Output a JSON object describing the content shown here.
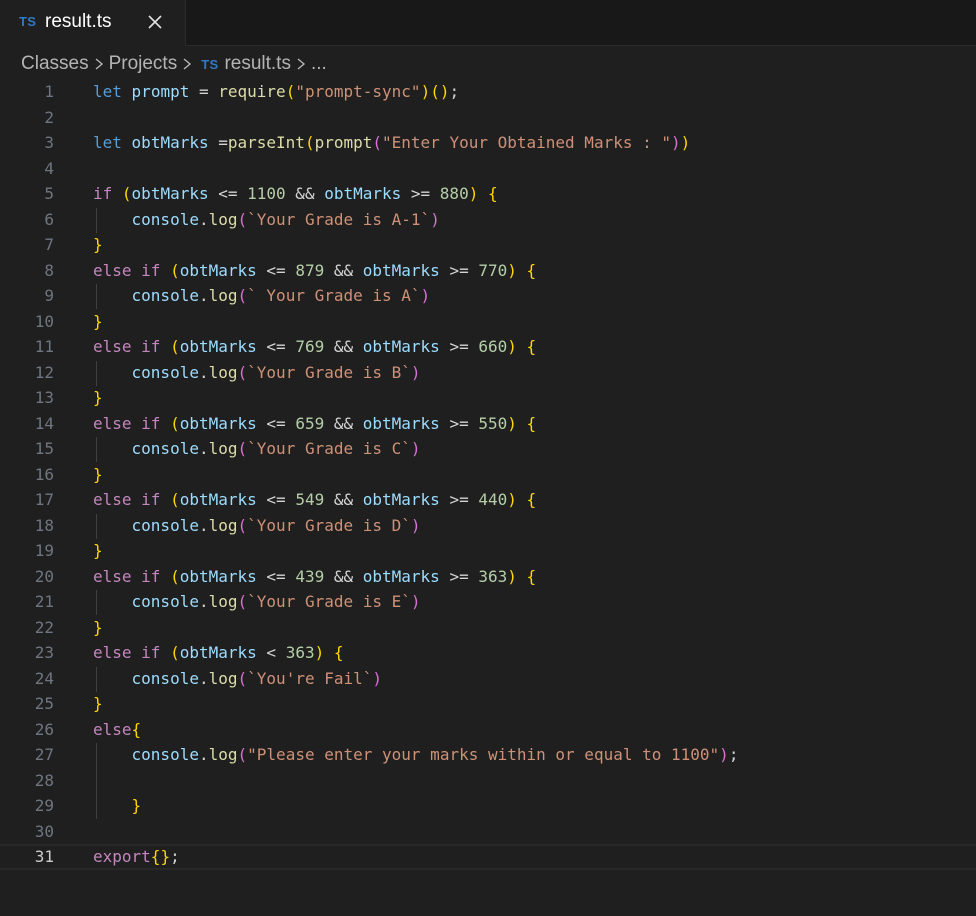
{
  "tab": {
    "badge": "TS",
    "title": "result.ts"
  },
  "breadcrumb": {
    "items": [
      "Classes",
      "Projects"
    ],
    "file_badge": "TS",
    "file": "result.ts",
    "more": "..."
  },
  "editor": {
    "current_line": 31,
    "lines": [
      {
        "n": "1",
        "t": [
          [
            "let",
            "kw"
          ],
          [
            " ",
            "op"
          ],
          [
            "prompt",
            "var"
          ],
          [
            " = ",
            "op"
          ],
          [
            "require",
            "fn"
          ],
          [
            "(",
            "p1"
          ],
          [
            "\"prompt-sync\"",
            "str"
          ],
          [
            ")",
            "p1"
          ],
          [
            "(",
            "p1"
          ],
          [
            ")",
            "p1"
          ],
          [
            ";",
            "op"
          ]
        ]
      },
      {
        "n": "2",
        "t": []
      },
      {
        "n": "3",
        "t": [
          [
            "let",
            "kw"
          ],
          [
            " ",
            "op"
          ],
          [
            "obtMarks",
            "var"
          ],
          [
            " =",
            "op"
          ],
          [
            "parseInt",
            "fn"
          ],
          [
            "(",
            "p1"
          ],
          [
            "prompt",
            "fn"
          ],
          [
            "(",
            "p2"
          ],
          [
            "\"Enter Your Obtained Marks : \"",
            "str"
          ],
          [
            ")",
            "p2"
          ],
          [
            ")",
            "p1"
          ]
        ]
      },
      {
        "n": "4",
        "t": []
      },
      {
        "n": "5",
        "t": [
          [
            "if",
            "ctrl"
          ],
          [
            " ",
            "op"
          ],
          [
            "(",
            "p1"
          ],
          [
            "obtMarks",
            "var"
          ],
          [
            " <= ",
            "op"
          ],
          [
            "1100",
            "num"
          ],
          [
            " && ",
            "op"
          ],
          [
            "obtMarks",
            "var"
          ],
          [
            " >= ",
            "op"
          ],
          [
            "880",
            "num"
          ],
          [
            ")",
            "p1"
          ],
          [
            " ",
            "op"
          ],
          [
            "{",
            "p1"
          ]
        ]
      },
      {
        "n": "6",
        "t": [
          [
            "    ",
            "op"
          ],
          [
            "console",
            "var"
          ],
          [
            ".",
            "op"
          ],
          [
            "log",
            "fn"
          ],
          [
            "(",
            "p2"
          ],
          [
            "`Your Grade is A-1`",
            "str"
          ],
          [
            ")",
            "p2"
          ]
        ]
      },
      {
        "n": "7",
        "t": [
          [
            "}",
            "p1"
          ]
        ]
      },
      {
        "n": "8",
        "t": [
          [
            "else",
            "ctrl"
          ],
          [
            " ",
            "op"
          ],
          [
            "if",
            "ctrl"
          ],
          [
            " ",
            "op"
          ],
          [
            "(",
            "p1"
          ],
          [
            "obtMarks",
            "var"
          ],
          [
            " <= ",
            "op"
          ],
          [
            "879",
            "num"
          ],
          [
            " && ",
            "op"
          ],
          [
            "obtMarks",
            "var"
          ],
          [
            " >= ",
            "op"
          ],
          [
            "770",
            "num"
          ],
          [
            ")",
            "p1"
          ],
          [
            " ",
            "op"
          ],
          [
            "{",
            "p1"
          ]
        ]
      },
      {
        "n": "9",
        "t": [
          [
            "    ",
            "op"
          ],
          [
            "console",
            "var"
          ],
          [
            ".",
            "op"
          ],
          [
            "log",
            "fn"
          ],
          [
            "(",
            "p2"
          ],
          [
            "` Your Grade is A`",
            "str"
          ],
          [
            ")",
            "p2"
          ]
        ]
      },
      {
        "n": "10",
        "t": [
          [
            "}",
            "p1"
          ]
        ]
      },
      {
        "n": "11",
        "t": [
          [
            "else",
            "ctrl"
          ],
          [
            " ",
            "op"
          ],
          [
            "if",
            "ctrl"
          ],
          [
            " ",
            "op"
          ],
          [
            "(",
            "p1"
          ],
          [
            "obtMarks",
            "var"
          ],
          [
            " <= ",
            "op"
          ],
          [
            "769",
            "num"
          ],
          [
            " && ",
            "op"
          ],
          [
            "obtMarks",
            "var"
          ],
          [
            " >= ",
            "op"
          ],
          [
            "660",
            "num"
          ],
          [
            ")",
            "p1"
          ],
          [
            " ",
            "op"
          ],
          [
            "{",
            "p1"
          ]
        ]
      },
      {
        "n": "12",
        "t": [
          [
            "    ",
            "op"
          ],
          [
            "console",
            "var"
          ],
          [
            ".",
            "op"
          ],
          [
            "log",
            "fn"
          ],
          [
            "(",
            "p2"
          ],
          [
            "`Your Grade is B`",
            "str"
          ],
          [
            ")",
            "p2"
          ]
        ]
      },
      {
        "n": "13",
        "t": [
          [
            "}",
            "p1"
          ]
        ]
      },
      {
        "n": "14",
        "t": [
          [
            "else",
            "ctrl"
          ],
          [
            " ",
            "op"
          ],
          [
            "if",
            "ctrl"
          ],
          [
            " ",
            "op"
          ],
          [
            "(",
            "p1"
          ],
          [
            "obtMarks",
            "var"
          ],
          [
            " <= ",
            "op"
          ],
          [
            "659",
            "num"
          ],
          [
            " && ",
            "op"
          ],
          [
            "obtMarks",
            "var"
          ],
          [
            " >= ",
            "op"
          ],
          [
            "550",
            "num"
          ],
          [
            ")",
            "p1"
          ],
          [
            " ",
            "op"
          ],
          [
            "{",
            "p1"
          ]
        ]
      },
      {
        "n": "15",
        "t": [
          [
            "    ",
            "op"
          ],
          [
            "console",
            "var"
          ],
          [
            ".",
            "op"
          ],
          [
            "log",
            "fn"
          ],
          [
            "(",
            "p2"
          ],
          [
            "`Your Grade is C`",
            "str"
          ],
          [
            ")",
            "p2"
          ]
        ]
      },
      {
        "n": "16",
        "t": [
          [
            "}",
            "p1"
          ]
        ]
      },
      {
        "n": "17",
        "t": [
          [
            "else",
            "ctrl"
          ],
          [
            " ",
            "op"
          ],
          [
            "if",
            "ctrl"
          ],
          [
            " ",
            "op"
          ],
          [
            "(",
            "p1"
          ],
          [
            "obtMarks",
            "var"
          ],
          [
            " <= ",
            "op"
          ],
          [
            "549",
            "num"
          ],
          [
            " && ",
            "op"
          ],
          [
            "obtMarks",
            "var"
          ],
          [
            " >= ",
            "op"
          ],
          [
            "440",
            "num"
          ],
          [
            ")",
            "p1"
          ],
          [
            " ",
            "op"
          ],
          [
            "{",
            "p1"
          ]
        ]
      },
      {
        "n": "18",
        "t": [
          [
            "    ",
            "op"
          ],
          [
            "console",
            "var"
          ],
          [
            ".",
            "op"
          ],
          [
            "log",
            "fn"
          ],
          [
            "(",
            "p2"
          ],
          [
            "`Your Grade is D`",
            "str"
          ],
          [
            ")",
            "p2"
          ]
        ]
      },
      {
        "n": "19",
        "t": [
          [
            "}",
            "p1"
          ]
        ]
      },
      {
        "n": "20",
        "t": [
          [
            "else",
            "ctrl"
          ],
          [
            " ",
            "op"
          ],
          [
            "if",
            "ctrl"
          ],
          [
            " ",
            "op"
          ],
          [
            "(",
            "p1"
          ],
          [
            "obtMarks",
            "var"
          ],
          [
            " <= ",
            "op"
          ],
          [
            "439",
            "num"
          ],
          [
            " && ",
            "op"
          ],
          [
            "obtMarks",
            "var"
          ],
          [
            " >= ",
            "op"
          ],
          [
            "363",
            "num"
          ],
          [
            ")",
            "p1"
          ],
          [
            " ",
            "op"
          ],
          [
            "{",
            "p1"
          ]
        ]
      },
      {
        "n": "21",
        "t": [
          [
            "    ",
            "op"
          ],
          [
            "console",
            "var"
          ],
          [
            ".",
            "op"
          ],
          [
            "log",
            "fn"
          ],
          [
            "(",
            "p2"
          ],
          [
            "`Your Grade is E`",
            "str"
          ],
          [
            ")",
            "p2"
          ]
        ]
      },
      {
        "n": "22",
        "t": [
          [
            "}",
            "p1"
          ]
        ]
      },
      {
        "n": "23",
        "t": [
          [
            "else",
            "ctrl"
          ],
          [
            " ",
            "op"
          ],
          [
            "if",
            "ctrl"
          ],
          [
            " ",
            "op"
          ],
          [
            "(",
            "p1"
          ],
          [
            "obtMarks",
            "var"
          ],
          [
            " < ",
            "op"
          ],
          [
            "363",
            "num"
          ],
          [
            ")",
            "p1"
          ],
          [
            " ",
            "op"
          ],
          [
            "{",
            "p1"
          ]
        ]
      },
      {
        "n": "24",
        "t": [
          [
            "    ",
            "op"
          ],
          [
            "console",
            "var"
          ],
          [
            ".",
            "op"
          ],
          [
            "log",
            "fn"
          ],
          [
            "(",
            "p2"
          ],
          [
            "`You're Fail`",
            "str"
          ],
          [
            ")",
            "p2"
          ]
        ]
      },
      {
        "n": "25",
        "t": [
          [
            "}",
            "p1"
          ]
        ]
      },
      {
        "n": "26",
        "t": [
          [
            "else",
            "ctrl"
          ],
          [
            "{",
            "p1"
          ]
        ]
      },
      {
        "n": "27",
        "t": [
          [
            "    ",
            "op"
          ],
          [
            "console",
            "var"
          ],
          [
            ".",
            "op"
          ],
          [
            "log",
            "fn"
          ],
          [
            "(",
            "p2"
          ],
          [
            "\"Please enter your marks within or equal to 1100\"",
            "str"
          ],
          [
            ")",
            "p2"
          ],
          [
            ";",
            "op"
          ]
        ]
      },
      {
        "n": "28",
        "t": []
      },
      {
        "n": "29",
        "t": [
          [
            "    ",
            "op"
          ],
          [
            "}",
            "p1"
          ]
        ]
      },
      {
        "n": "30",
        "t": []
      },
      {
        "n": "31",
        "t": [
          [
            "export",
            "ctrl"
          ],
          [
            "{",
            "p1"
          ],
          [
            "}",
            "p1"
          ],
          [
            ";",
            "op"
          ]
        ]
      }
    ]
  }
}
